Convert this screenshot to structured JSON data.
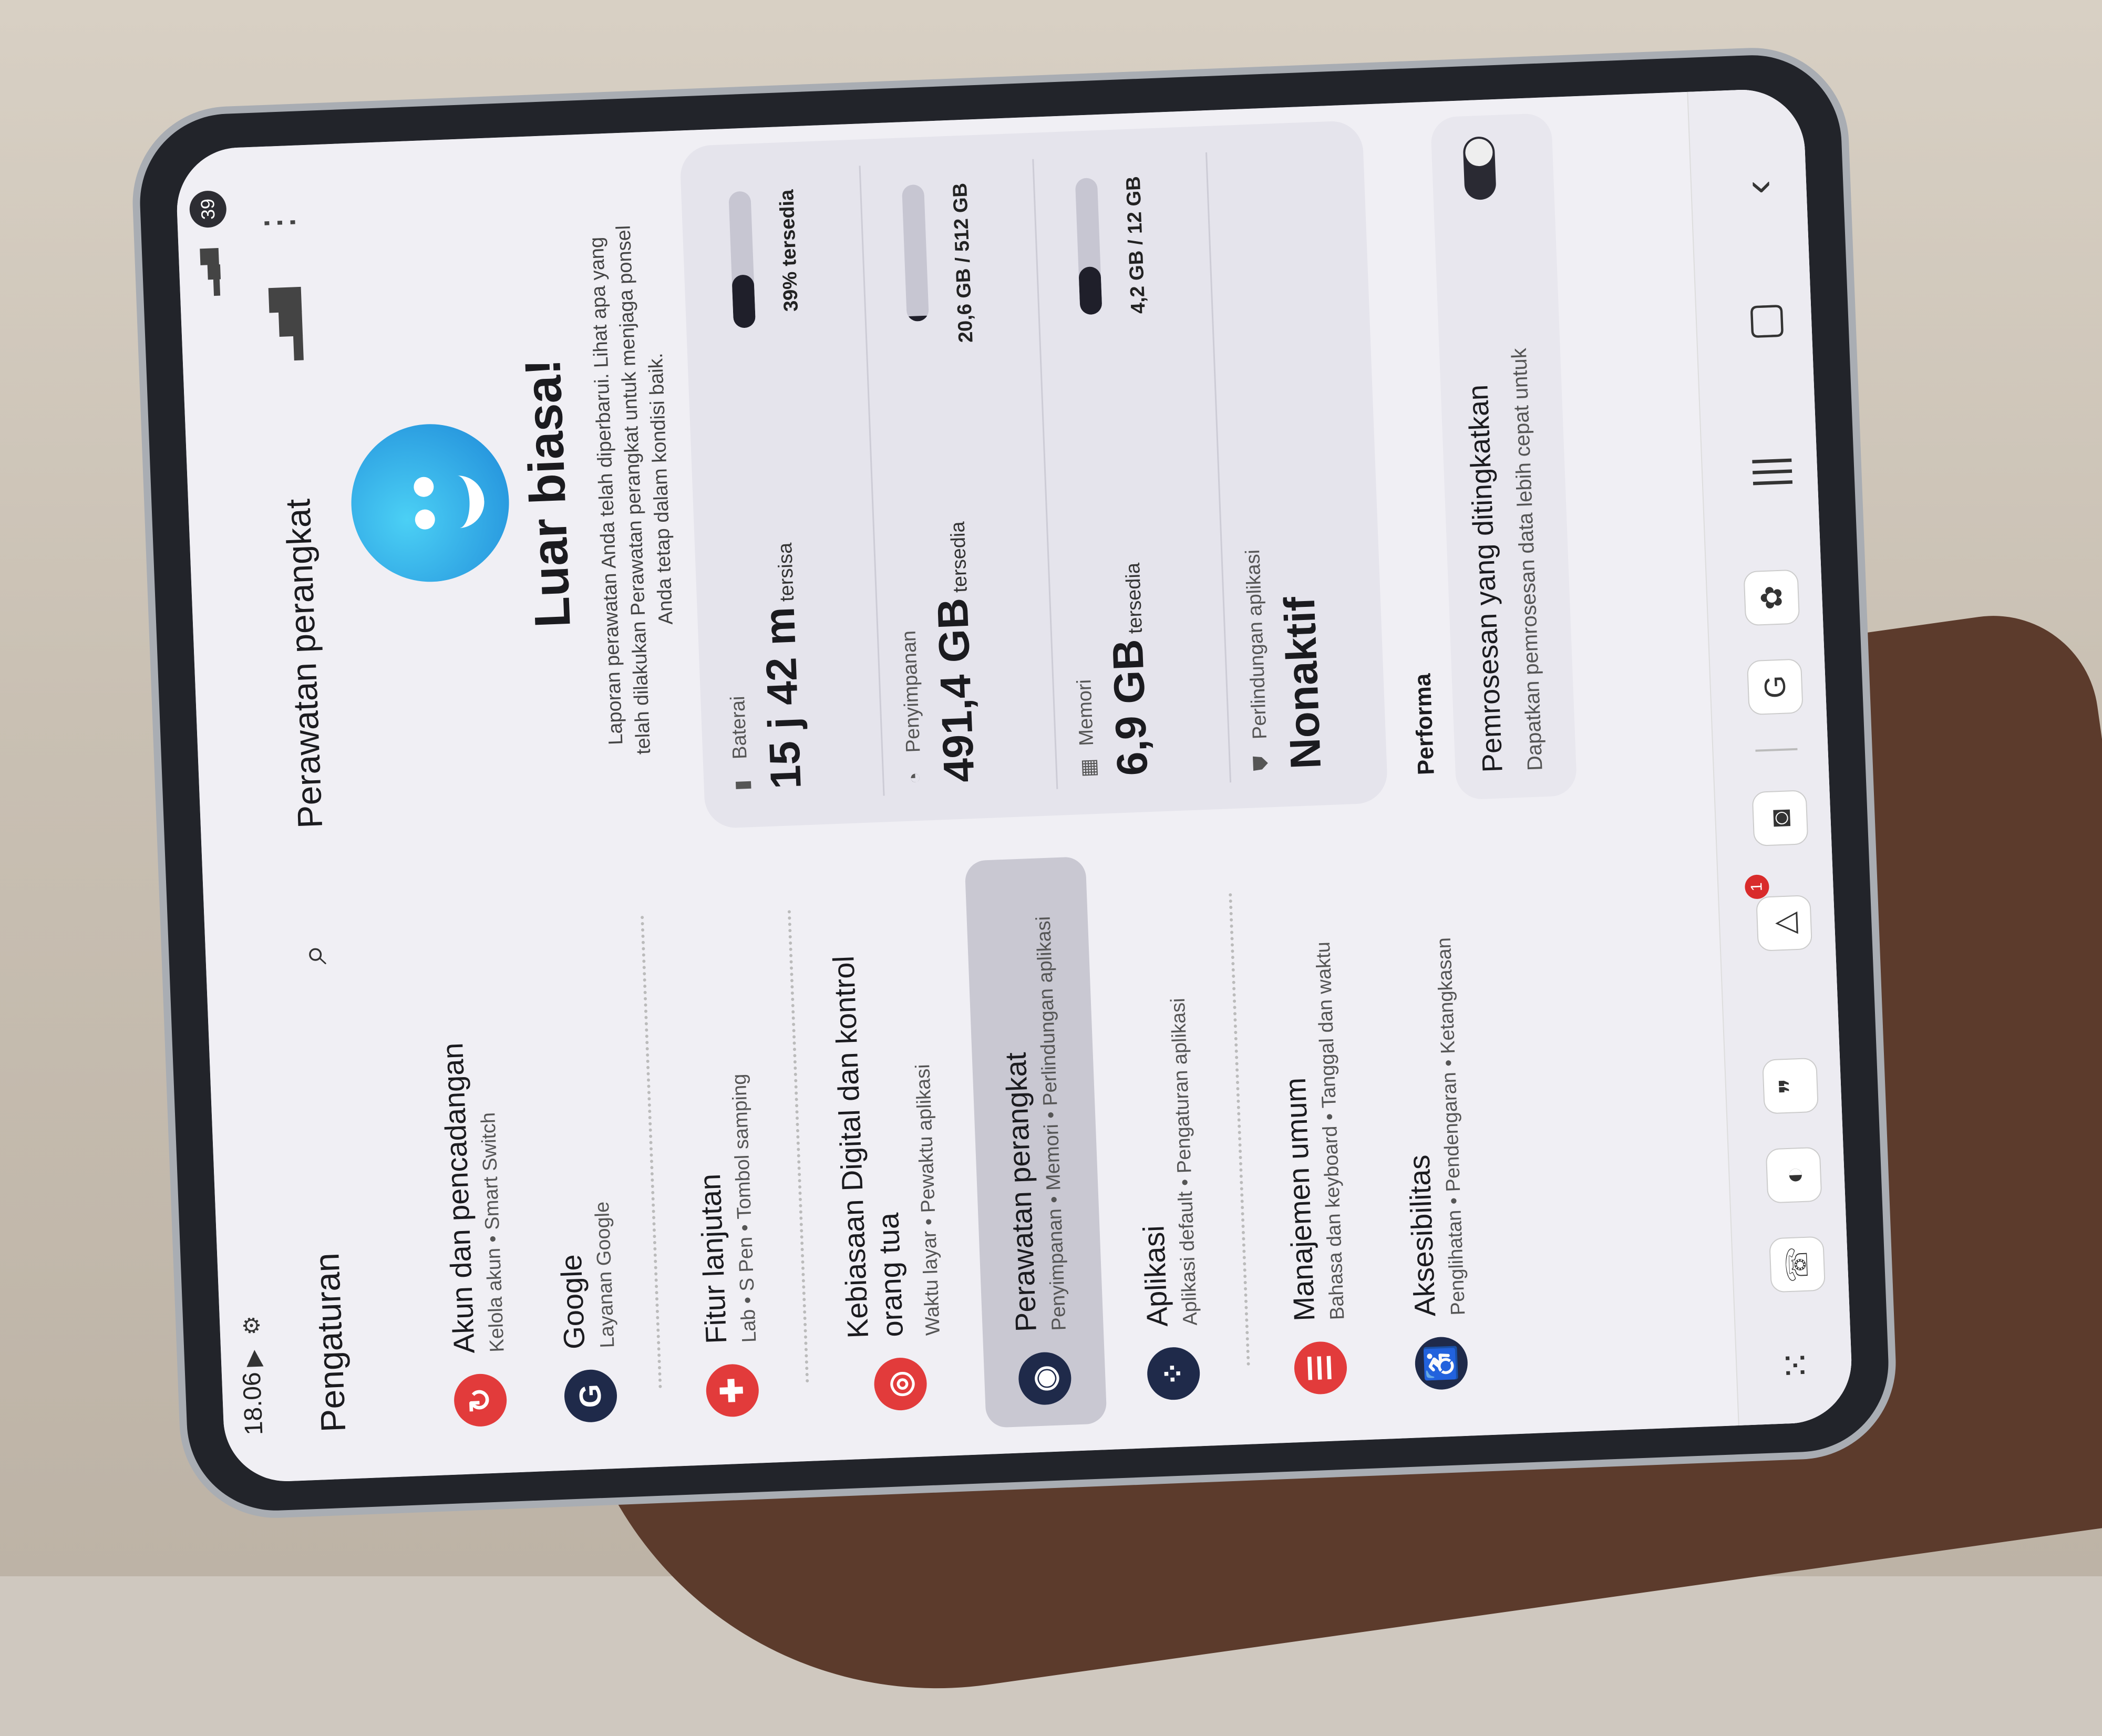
{
  "status_bar": {
    "time": "18.06",
    "battery": "39"
  },
  "left_pane": {
    "title": "Pengaturan",
    "items": [
      {
        "title": "Akun dan pencadangan",
        "subtitle": "Kelola akun  •  Smart Switch",
        "icon": "sync-icon",
        "color": "#e23b3b"
      },
      {
        "title": "Google",
        "subtitle": "Layanan Google",
        "icon": "google-g-icon",
        "color": "#1f2a4a"
      },
      {
        "title": "Fitur lanjutan",
        "subtitle": "Lab  •  S Pen  •  Tombol samping",
        "icon": "gear-plus-icon",
        "color": "#e23b3b"
      },
      {
        "title": "Kebiasaan Digital dan kontrol orang tua",
        "subtitle": "Waktu layar  •  Pewaktu aplikasi",
        "icon": "digital-wellbeing-icon",
        "color": "#e23b3b"
      },
      {
        "title": "Perawatan perangkat",
        "subtitle": "Penyimpanan  •  Memori  •  Perlindungan aplikasi",
        "icon": "device-care-icon",
        "color": "#1f2a4a"
      },
      {
        "title": "Aplikasi",
        "subtitle": "Aplikasi default  •  Pengaturan aplikasi",
        "icon": "apps-dots-icon",
        "color": "#1f2a4a"
      },
      {
        "title": "Manajemen umum",
        "subtitle": "Bahasa dan keyboard  •  Tanggal dan waktu",
        "icon": "sliders-icon",
        "color": "#e23b3b"
      },
      {
        "title": "Aksesibilitas",
        "subtitle": "Penglihatan  •  Pendengaran  •  Ketangkasan",
        "icon": "accessibility-icon",
        "color": "#1f2a4a"
      }
    ]
  },
  "right_pane": {
    "title": "Perawatan perangkat",
    "headline": "Luar biasa!",
    "description": "Laporan perawatan Anda telah diperbarui. Lihat apa yang telah dilakukan Perawatan perangkat untuk menjaga ponsel Anda tetap dalam kondisi baik.",
    "stats": {
      "battery": {
        "label": "Baterai",
        "value": "15 j 42 m",
        "suffix": "tersisa",
        "right": "39% tersedia",
        "fill": 0.39
      },
      "storage": {
        "label": "Penyimpanan",
        "value": "491,4 GB",
        "suffix": "tersedia",
        "right": "20,6 GB / 512 GB",
        "fill": 0.04
      },
      "memory": {
        "label": "Memori",
        "value": "6,9 GB",
        "suffix": "tersedia",
        "right": "4,2 GB / 12 GB",
        "fill": 0.35
      },
      "app_protection": {
        "label": "Perlindungan aplikasi",
        "value": "Nonaktif"
      }
    },
    "performance_label": "Performa",
    "performance_card": {
      "title": "Pemrosesan yang ditingkatkan",
      "description": "Dapatkan pemrosesan data lebih cepat untuk"
    }
  },
  "taskbar": {
    "badge_count": "1"
  }
}
